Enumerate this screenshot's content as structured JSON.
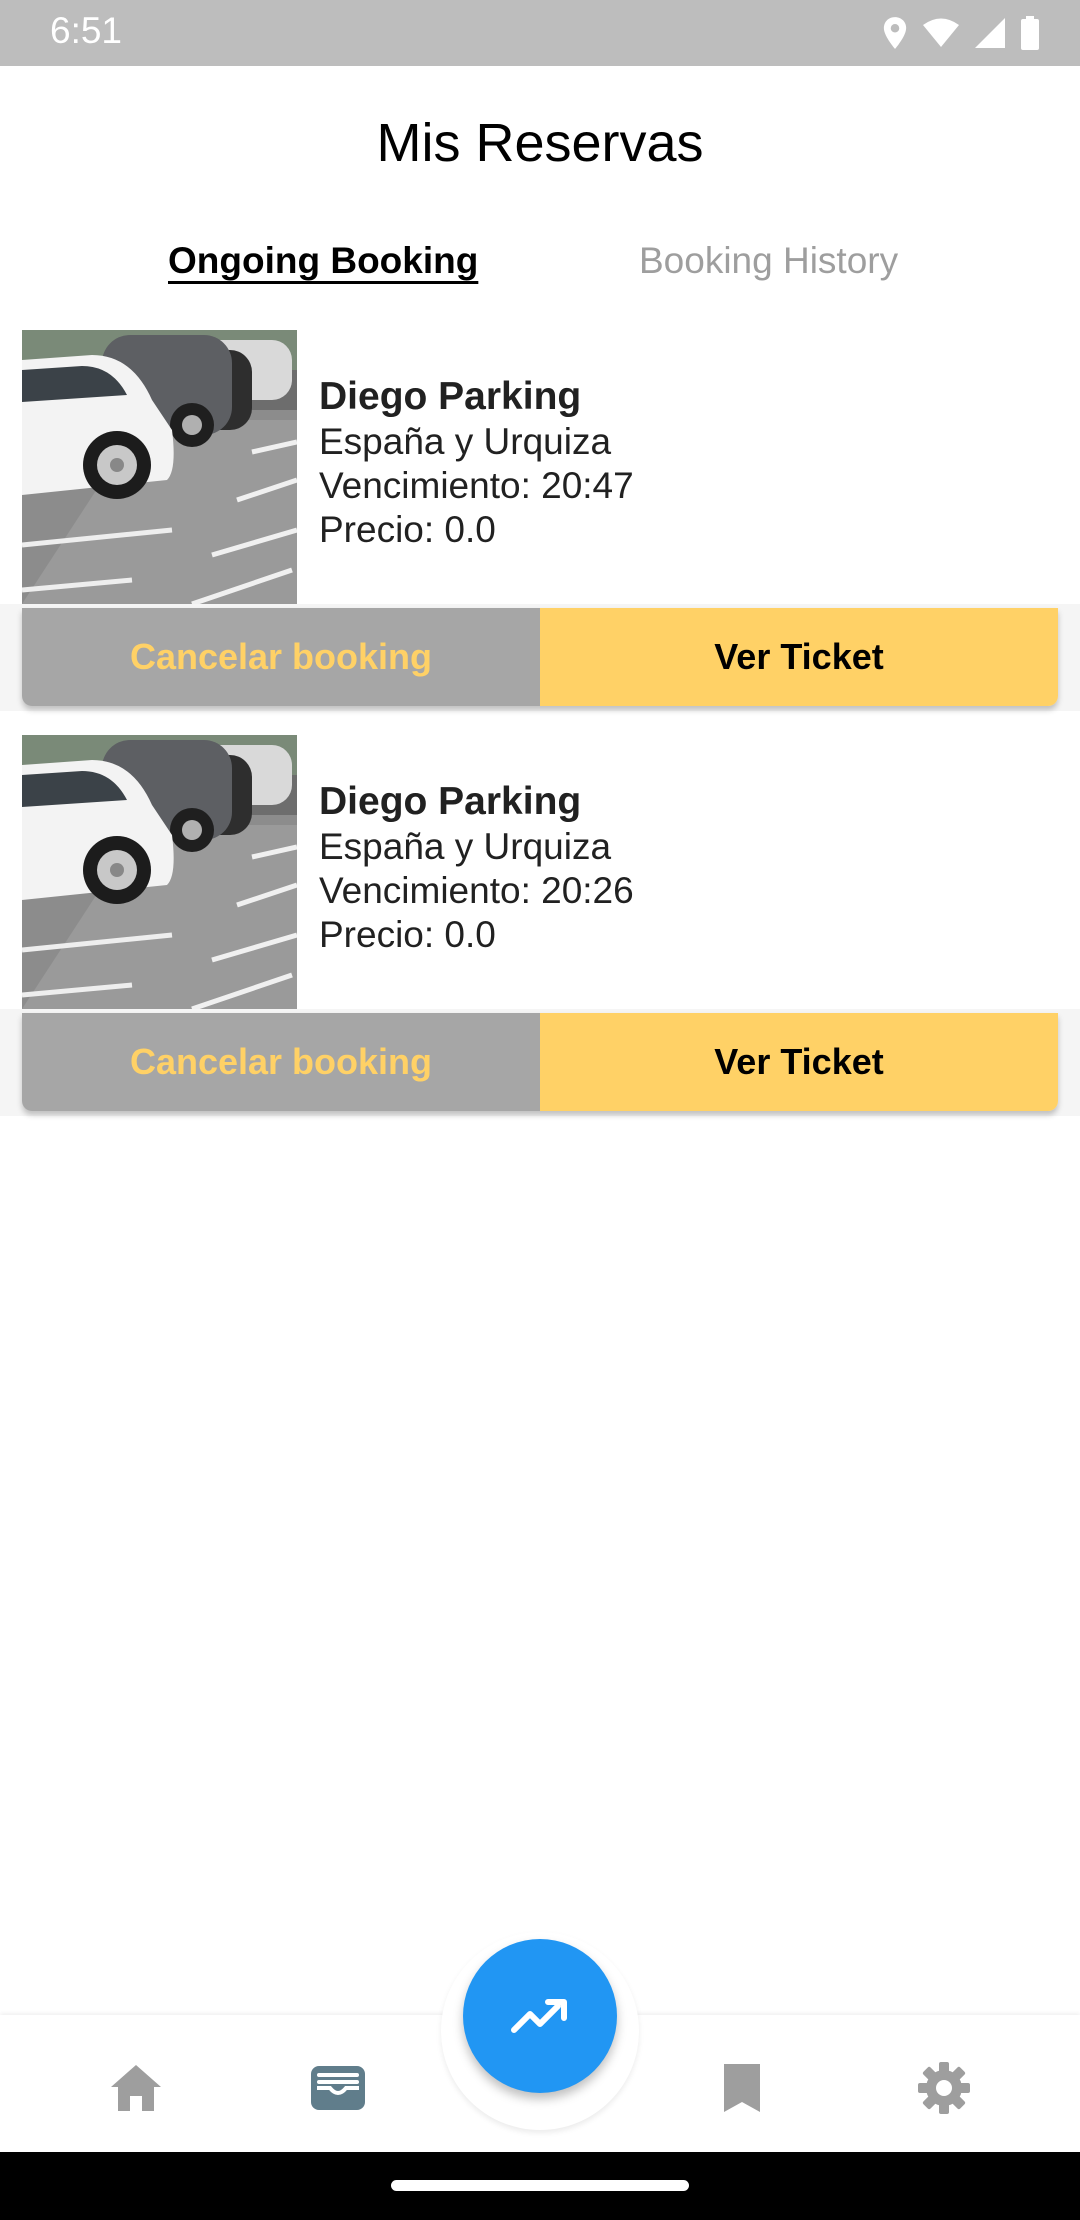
{
  "status_bar": {
    "time": "6:51",
    "icons": [
      "location-icon",
      "wifi-icon",
      "signal-icon",
      "battery-icon"
    ]
  },
  "header": {
    "title": "Mis Reservas"
  },
  "tabs": [
    {
      "label": "Ongoing Booking",
      "active": true
    },
    {
      "label": "Booking History",
      "active": false
    }
  ],
  "bookings": [
    {
      "name": "Diego Parking",
      "address": "España y Urquiza",
      "expiry": "Vencimiento: 20:47",
      "price": "Precio: 0.0",
      "cancel_label": "Cancelar booking",
      "ticket_label": "Ver Ticket"
    },
    {
      "name": "Diego Parking",
      "address": "España y Urquiza",
      "expiry": "Vencimiento: 20:26",
      "price": "Precio: 0.0",
      "cancel_label": "Cancelar booking",
      "ticket_label": "Ver Ticket"
    }
  ],
  "bottom_nav": {
    "items": [
      "home-icon",
      "wallet-icon",
      "trending-up-icon",
      "bookmark-icon",
      "settings-icon"
    ],
    "active": "wallet-icon"
  },
  "colors": {
    "accent_yellow": "#ffd166",
    "cancel_gray": "#a6a6a6",
    "fab_blue": "#2196f3",
    "nav_icon_gray": "#9e9e9e",
    "nav_icon_active": "#607d8b"
  }
}
